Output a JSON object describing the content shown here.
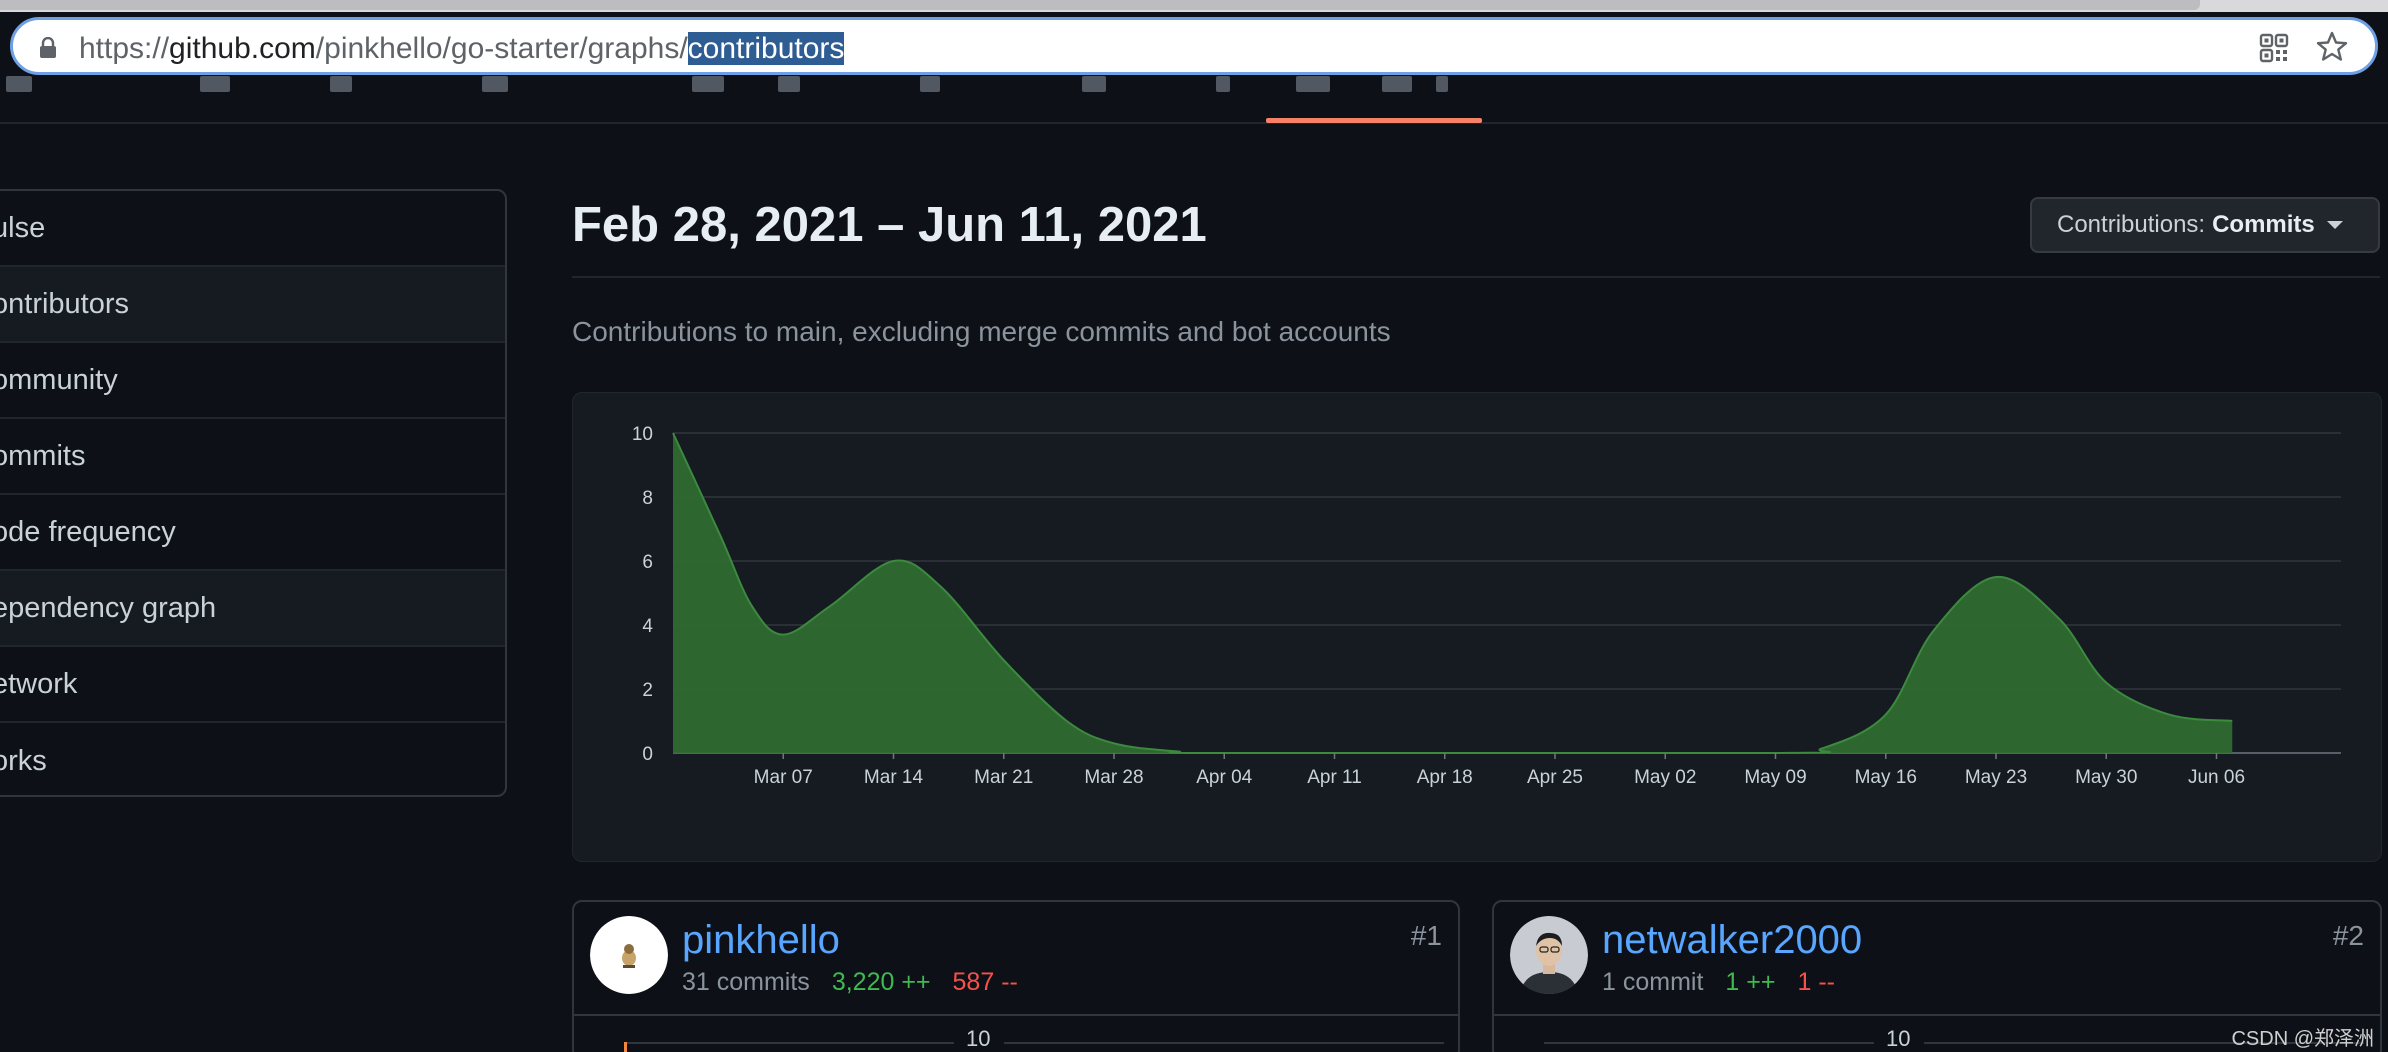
{
  "browser": {
    "url_prefix": "https://",
    "url_host": "github.com",
    "url_path": "/pinkhello/go-starter/graphs/",
    "url_selected": "contributors"
  },
  "sidebar": {
    "items": [
      {
        "label": "ulse"
      },
      {
        "label": "ontributors"
      },
      {
        "label": "ommunity"
      },
      {
        "label": "ommits"
      },
      {
        "label": "ode frequency"
      },
      {
        "label": "ependency graph"
      },
      {
        "label": "etwork"
      },
      {
        "label": "orks"
      }
    ]
  },
  "header": {
    "date_range": "Feb 28, 2021 – Jun 11, 2021",
    "contributions_label": "Contributions:",
    "contributions_value": "Commits"
  },
  "subtitle": "Contributions to main, excluding merge commits and bot accounts",
  "chart_data": {
    "type": "area",
    "ylim": [
      0,
      10
    ],
    "y_ticks": [
      "0",
      "2",
      "4",
      "6",
      "8",
      "10"
    ],
    "x_ticks": [
      "Mar 07",
      "Mar 14",
      "Mar 21",
      "Mar 28",
      "Apr 04",
      "Apr 11",
      "Apr 18",
      "Apr 25",
      "May 02",
      "May 09",
      "May 16",
      "May 23",
      "May 30",
      "Jun 06"
    ],
    "grid": true,
    "series": [
      {
        "color": "#2f6a31",
        "line_color": "#3b8a3e",
        "points": [
          [
            "2021-02-28",
            10
          ],
          [
            "2021-03-03",
            6.8
          ],
          [
            "2021-03-05",
            4.6
          ],
          [
            "2021-03-07",
            3.7
          ],
          [
            "2021-03-10",
            4.6
          ],
          [
            "2021-03-14",
            6.0
          ],
          [
            "2021-03-17",
            5.2
          ],
          [
            "2021-03-21",
            2.9
          ],
          [
            "2021-03-25",
            1.0
          ],
          [
            "2021-03-28",
            0.3
          ],
          [
            "2021-04-01",
            0.05
          ],
          [
            "2021-04-04",
            0
          ],
          [
            "2021-05-09",
            0
          ],
          [
            "2021-05-12",
            0.15
          ],
          [
            "2021-05-16",
            1.2
          ],
          [
            "2021-05-19",
            3.8
          ],
          [
            "2021-05-23",
            5.5
          ],
          [
            "2021-05-27",
            4.2
          ],
          [
            "2021-05-30",
            2.2
          ],
          [
            "2021-06-03",
            1.2
          ],
          [
            "2021-06-07",
            1.0
          ]
        ]
      }
    ]
  },
  "contributors": [
    {
      "username": "pinkhello",
      "commits": "31 commits",
      "additions": "3,220 ++",
      "deletions": "587 --",
      "rank": "#1",
      "mini_tick": "10"
    },
    {
      "username": "netwalker2000",
      "commits": "1 commit",
      "additions": "1 ++",
      "deletions": "1 --",
      "rank": "#2",
      "mini_tick": "10"
    }
  ],
  "watermark": "CSDN @郑泽洲"
}
